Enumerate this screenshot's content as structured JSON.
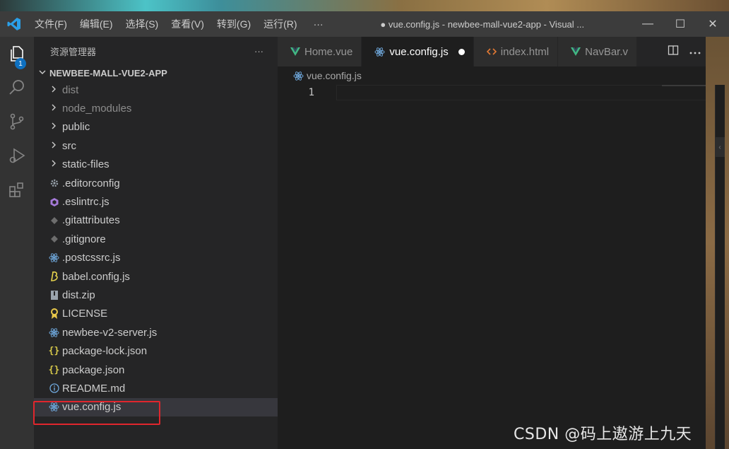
{
  "titlebar": {
    "menu": [
      "文件(F)",
      "编辑(E)",
      "选择(S)",
      "查看(V)",
      "转到(G)",
      "运行(R)"
    ],
    "more": "···",
    "title": "● vue.config.js - newbee-mall-vue2-app - Visual ...",
    "controls": [
      "—",
      "☐",
      "✕"
    ]
  },
  "activity": {
    "badge": "1",
    "icons": [
      "explorer-icon",
      "search-icon",
      "source-control-icon",
      "run-debug-icon",
      "extensions-icon"
    ]
  },
  "sidebar": {
    "header": "资源管理器",
    "header_more": "···",
    "root": "NEWBEE-MALL-VUE2-APP",
    "folders": [
      {
        "label": "dist",
        "dim": true
      },
      {
        "label": "node_modules",
        "dim": true
      },
      {
        "label": "public",
        "dim": false
      },
      {
        "label": "src",
        "dim": false
      },
      {
        "label": "static-files",
        "dim": false
      }
    ],
    "files": [
      {
        "label": ".editorconfig",
        "icon": "gear-icon",
        "color": "#9aa4ad"
      },
      {
        "label": ".eslintrc.js",
        "icon": "eslint-icon",
        "color": "#a57ad8"
      },
      {
        "label": ".gitattributes",
        "icon": "git-icon",
        "color": "#6d6d6d"
      },
      {
        "label": ".gitignore",
        "icon": "git-icon",
        "color": "#6d6d6d"
      },
      {
        "label": ".postcssrc.js",
        "icon": "react-icon",
        "color": "#6fa8dc"
      },
      {
        "label": "babel.config.js",
        "icon": "babel-icon",
        "color": "#e8d44d"
      },
      {
        "label": "dist.zip",
        "icon": "zip-icon",
        "color": "#9aa4ad"
      },
      {
        "label": "LICENSE",
        "icon": "license-icon",
        "color": "#e8c84a"
      },
      {
        "label": "newbee-v2-server.js",
        "icon": "react-icon",
        "color": "#6fa8dc"
      },
      {
        "label": "package-lock.json",
        "icon": "json-icon",
        "color": "#d6c84a"
      },
      {
        "label": "package.json",
        "icon": "json-icon",
        "color": "#d6c84a"
      },
      {
        "label": "README.md",
        "icon": "info-icon",
        "color": "#6fa8dc"
      },
      {
        "label": "vue.config.js",
        "icon": "react-icon",
        "color": "#6fa8dc",
        "selected": true
      }
    ]
  },
  "editor": {
    "tabs": [
      {
        "label": "Home.vue",
        "icon": "vue-icon",
        "active": false
      },
      {
        "label": "vue.config.js",
        "icon": "react-icon",
        "active": true,
        "dirty": true
      },
      {
        "label": "index.html",
        "icon": "html-icon",
        "active": false
      },
      {
        "label": "NavBar.v",
        "icon": "vue-icon",
        "active": false
      }
    ],
    "breadcrumb": "vue.config.js",
    "lines": [
      "1"
    ]
  },
  "watermark": "CSDN @码上遨游上九天"
}
